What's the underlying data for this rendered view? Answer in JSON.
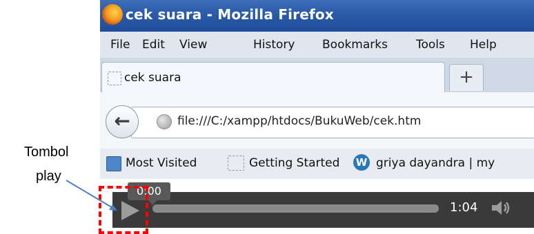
{
  "window": {
    "title": "cek suara - Mozilla Firefox"
  },
  "menu": {
    "file": "File",
    "edit": "Edit",
    "view": "View",
    "history": "History",
    "bookmarks": "Bookmarks",
    "tools": "Tools",
    "help": "Help"
  },
  "tab": {
    "label": "cek suara",
    "new_tab_label": "+"
  },
  "nav": {
    "back_glyph": "←",
    "url": "file:///C:/xampp/htdocs/BukuWeb/cek.htm"
  },
  "bookmarks_bar": {
    "items": [
      {
        "label": "Most Visited"
      },
      {
        "label": "Getting Started"
      },
      {
        "label": "griya dayandra | my"
      }
    ]
  },
  "player": {
    "current_time_tooltip": "0:00",
    "duration": "1:04",
    "progress_fraction": 0
  },
  "annotation": {
    "line1": "Tombol",
    "line2": "play"
  },
  "colors": {
    "titlebar": "#2a5aa8",
    "controls": "#3a3a3a",
    "highlight": "#ff0000",
    "arrow": "#4a80c2"
  },
  "icons": [
    "firefox-logo",
    "blank-page",
    "back-arrow",
    "globe",
    "folder-star",
    "wordpress",
    "play",
    "volume"
  ]
}
